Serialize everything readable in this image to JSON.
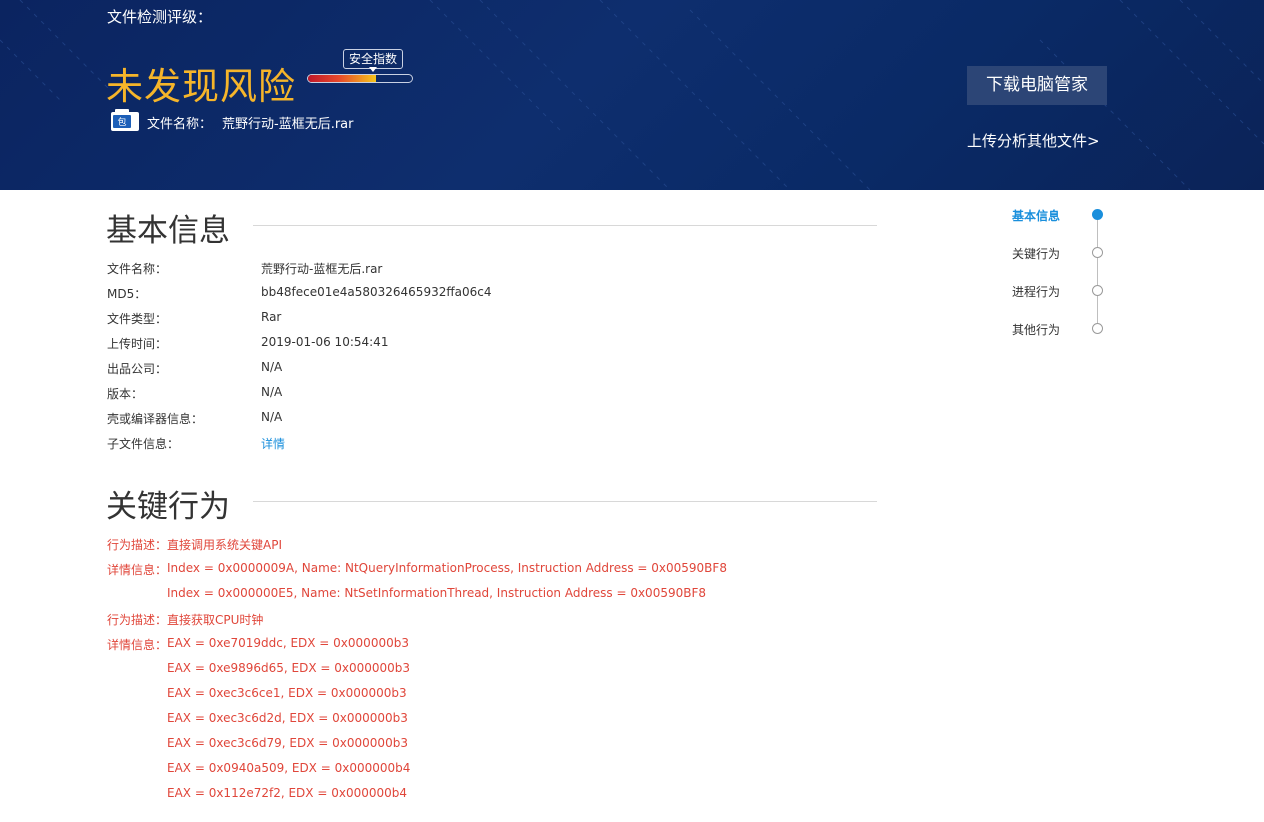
{
  "header": {
    "detect_label": "文件检测评级：",
    "risk_text": "未发现风险",
    "safety_index_label": "安全指数",
    "safety_index_level": 0.65,
    "file_icon_char": "包",
    "file_name_label": "文件名称：",
    "file_name": "荒野行动-蓝框无后.rar",
    "download_button": "下载电脑管家",
    "upload_link": "上传分析其他文件>",
    "colors": {
      "banner": "#0b2460",
      "risk": "#f6b52a",
      "button": "#2c4576"
    }
  },
  "basic_info": {
    "title": "基本信息",
    "rows": [
      {
        "key": "文件名称：",
        "value": "荒野行动-蓝框无后.rar"
      },
      {
        "key": "MD5：",
        "value": "bb48fece01e4a580326465932ffa06c4"
      },
      {
        "key": "文件类型：",
        "value": "Rar"
      },
      {
        "key": "上传时间：",
        "value": "2019-01-06 10:54:41"
      },
      {
        "key": "出品公司：",
        "value": "N/A"
      },
      {
        "key": "版本：",
        "value": "N/A"
      },
      {
        "key": "壳或编译器信息：",
        "value": "N/A"
      },
      {
        "key": "子文件信息：",
        "value": "详情"
      }
    ]
  },
  "key_behavior": {
    "title": "关键行为",
    "rows": [
      {
        "key": "行为描述：",
        "value": "直接调用系统关键API"
      },
      {
        "key": "详情信息：",
        "value": "Index = 0x0000009A, Name: NtQueryInformationProcess, Instruction Address = 0x00590BF8"
      },
      {
        "key": "",
        "value": "Index = 0x000000E5, Name: NtSetInformationThread, Instruction Address = 0x00590BF8"
      },
      {
        "key": "行为描述：",
        "value": "直接获取CPU时钟"
      },
      {
        "key": "详情信息：",
        "value": "EAX = 0xe7019ddc, EDX = 0x000000b3"
      },
      {
        "key": "",
        "value": "EAX = 0xe9896d65, EDX = 0x000000b3"
      },
      {
        "key": "",
        "value": "EAX = 0xec3c6ce1, EDX = 0x000000b3"
      },
      {
        "key": "",
        "value": "EAX = 0xec3c6d2d, EDX = 0x000000b3"
      },
      {
        "key": "",
        "value": "EAX = 0xec3c6d79, EDX = 0x000000b3"
      },
      {
        "key": "",
        "value": "EAX = 0x0940a509, EDX = 0x000000b4"
      },
      {
        "key": "",
        "value": "EAX = 0x112e72f2, EDX = 0x000000b4"
      }
    ],
    "color": "#e0463a"
  },
  "side_nav": {
    "items": [
      "基本信息",
      "关键行为",
      "进程行为",
      "其他行为"
    ],
    "active_index": 0,
    "active_color": "#1a8fdc"
  }
}
